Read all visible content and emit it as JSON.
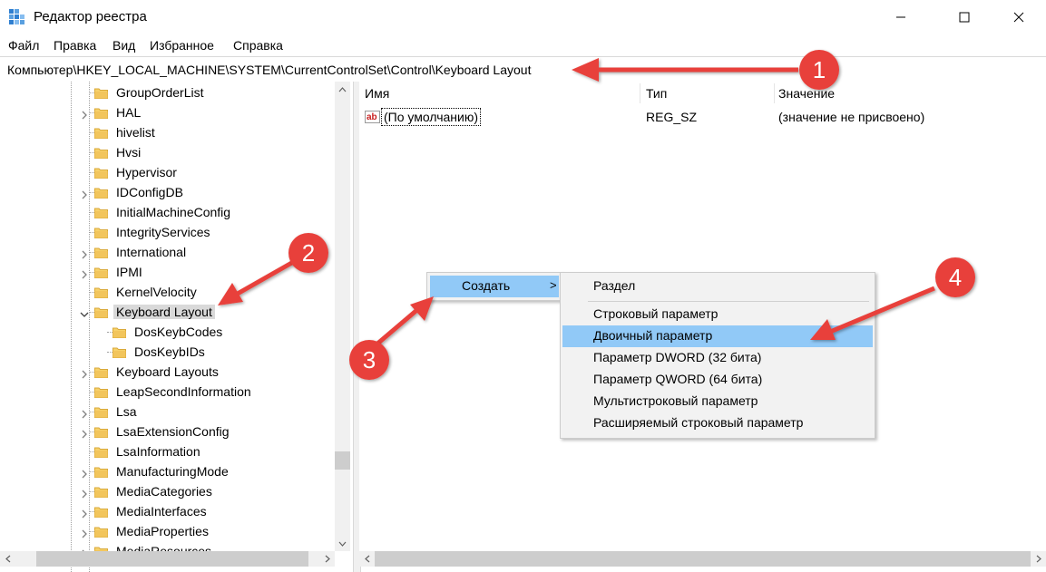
{
  "window": {
    "title": "Редактор реестра"
  },
  "menu": [
    "Файл",
    "Правка",
    "Вид",
    "Избранное",
    "Справка"
  ],
  "address": "Компьютер\\HKEY_LOCAL_MACHINE\\SYSTEM\\CurrentControlSet\\Control\\Keyboard Layout",
  "tree": [
    {
      "label": "GroupOrderList",
      "expander": false,
      "level": 1
    },
    {
      "label": "HAL",
      "expander": true,
      "level": 1
    },
    {
      "label": "hivelist",
      "expander": false,
      "level": 1
    },
    {
      "label": "Hvsi",
      "expander": false,
      "level": 1
    },
    {
      "label": "Hypervisor",
      "expander": false,
      "level": 1
    },
    {
      "label": "IDConfigDB",
      "expander": true,
      "level": 1
    },
    {
      "label": "InitialMachineConfig",
      "expander": false,
      "level": 1
    },
    {
      "label": "IntegrityServices",
      "expander": false,
      "level": 1
    },
    {
      "label": "International",
      "expander": true,
      "level": 1
    },
    {
      "label": "IPMI",
      "expander": true,
      "level": 1
    },
    {
      "label": "KernelVelocity",
      "expander": false,
      "level": 1
    },
    {
      "label": "Keyboard Layout",
      "expander": "open",
      "level": 1,
      "selected": true
    },
    {
      "label": "DosKeybCodes",
      "expander": false,
      "level": 2
    },
    {
      "label": "DosKeybIDs",
      "expander": false,
      "level": 2
    },
    {
      "label": "Keyboard Layouts",
      "expander": true,
      "level": 1
    },
    {
      "label": "LeapSecondInformation",
      "expander": false,
      "level": 1
    },
    {
      "label": "Lsa",
      "expander": true,
      "level": 1
    },
    {
      "label": "LsaExtensionConfig",
      "expander": true,
      "level": 1
    },
    {
      "label": "LsaInformation",
      "expander": false,
      "level": 1
    },
    {
      "label": "ManufacturingMode",
      "expander": true,
      "level": 1
    },
    {
      "label": "MediaCategories",
      "expander": true,
      "level": 1
    },
    {
      "label": "MediaInterfaces",
      "expander": true,
      "level": 1
    },
    {
      "label": "MediaProperties",
      "expander": true,
      "level": 1
    },
    {
      "label": "MediaResources",
      "expander": true,
      "level": 1
    }
  ],
  "list": {
    "headers": {
      "name": "Имя",
      "type": "Тип",
      "value": "Значение"
    },
    "rows": [
      {
        "name": "(По умолчанию)",
        "type": "REG_SZ",
        "value": "(значение не присвоено)",
        "icon": "ab-string-icon"
      }
    ]
  },
  "context_menu": {
    "create_label": "Создать",
    "create_arrow": ">",
    "submenu": [
      {
        "label": "Раздел"
      },
      {
        "label": "Строковый параметр"
      },
      {
        "label": "Двоичный параметр",
        "highlighted": true
      },
      {
        "label": "Параметр DWORD (32 бита)"
      },
      {
        "label": "Параметр QWORD (64 бита)"
      },
      {
        "label": "Мультистроковый параметр"
      },
      {
        "label": "Расширяемый строковый параметр"
      }
    ]
  },
  "annotations": {
    "badges": [
      "1",
      "2",
      "3",
      "4"
    ],
    "color": "#e8403a"
  },
  "colors": {
    "selection": "#91c9f7",
    "tree_selected": "#d9d9d9",
    "folder": "#f2c55c",
    "annotation_red": "#e8403a"
  }
}
